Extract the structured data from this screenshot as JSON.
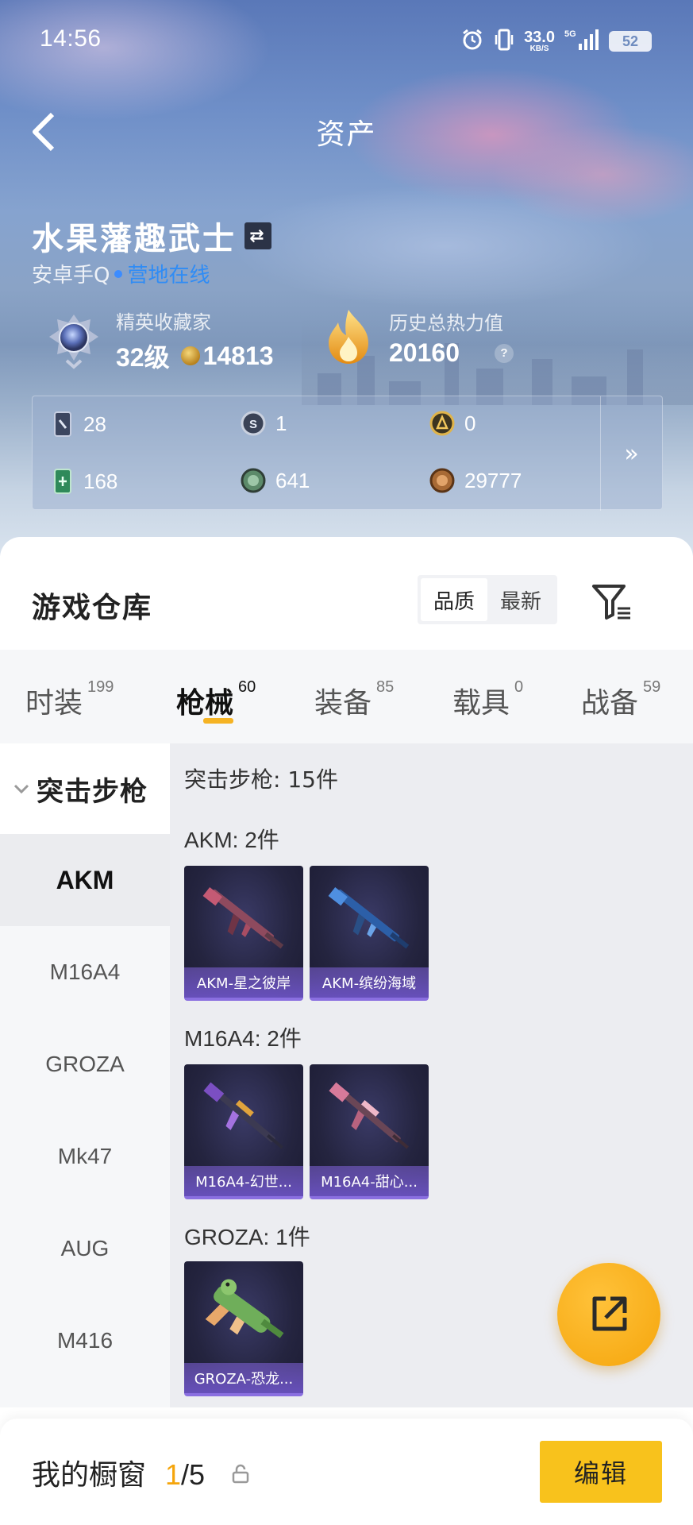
{
  "status_bar": {
    "time": "14:56",
    "speed_value": "33.0",
    "speed_unit": "KB/S",
    "network": "5G",
    "battery": "52"
  },
  "header": {
    "title": "资产",
    "player_name": "水果藩趣武士",
    "server": "安卓手Q",
    "online_status": "营地在线",
    "collector": {
      "label": "精英收藏家",
      "level": "32级",
      "points": "14813"
    },
    "heat": {
      "label": "历史总热力值",
      "value": "20160",
      "help": "?"
    },
    "resources": [
      {
        "icon": "card-icon",
        "value": "28"
      },
      {
        "icon": "silver-coin-icon",
        "value": "1"
      },
      {
        "icon": "gold-coin-icon",
        "value": "0"
      },
      {
        "icon": "green-ticket-icon",
        "value": "168"
      },
      {
        "icon": "green-coin-icon",
        "value": "641"
      },
      {
        "icon": "bronze-coin-icon",
        "value": "29777"
      }
    ],
    "more": "»"
  },
  "warehouse": {
    "title": "游戏仓库",
    "sort": {
      "options": [
        "品质",
        "最新"
      ],
      "selected": "品质"
    },
    "tabs": [
      {
        "label": "时装",
        "count": "199"
      },
      {
        "label": "枪械",
        "count": "60",
        "active": true
      },
      {
        "label": "装备",
        "count": "85"
      },
      {
        "label": "载具",
        "count": "0"
      },
      {
        "label": "战备",
        "count": "59"
      }
    ],
    "category": "突击步枪",
    "sidebar": [
      "AKM",
      "M16A4",
      "GROZA",
      "Mk47",
      "AUG",
      "M416"
    ],
    "selected_weapon": "AKM",
    "total": "突击步枪: 15件",
    "groups": [
      {
        "title": "AKM: 2件",
        "items": [
          "AKM-星之彼岸",
          "AKM-缤纷海域"
        ]
      },
      {
        "title": "M16A4: 2件",
        "items": [
          "M16A4-幻世...",
          "M16A4-甜心..."
        ]
      },
      {
        "title": "GROZA: 1件",
        "items": [
          "GROZA-恐龙..."
        ]
      }
    ]
  },
  "bottom": {
    "showcase_label": "我的橱窗",
    "showcase_current": "1",
    "showcase_total": "/5",
    "edit": "编辑"
  },
  "colors": {
    "accent": "#f5b324",
    "online": "#2f8cf5",
    "edit_button": "#f8c21c",
    "card_bar": "#8a6fe0"
  }
}
